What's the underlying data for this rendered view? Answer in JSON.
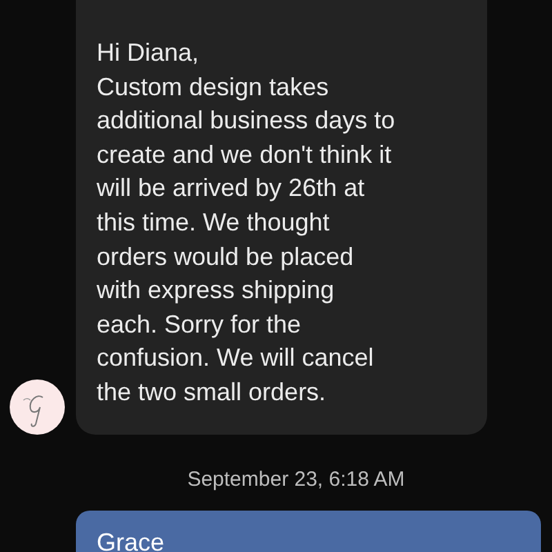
{
  "messages": [
    {
      "kind": "incoming",
      "text": "Hi Diana,\nCustom design takes\nadditional business days to\ncreate and we don't think it\nwill be arrived by 26th at\nthis time. We thought\norders would be placed\nwith express shipping\neach. Sorry for the\nconfusion. We will cancel\nthe two small orders."
    },
    {
      "kind": "timestamp",
      "text": "September 23, 6:18 AM"
    },
    {
      "kind": "outgoing",
      "text": "Grace"
    }
  ]
}
